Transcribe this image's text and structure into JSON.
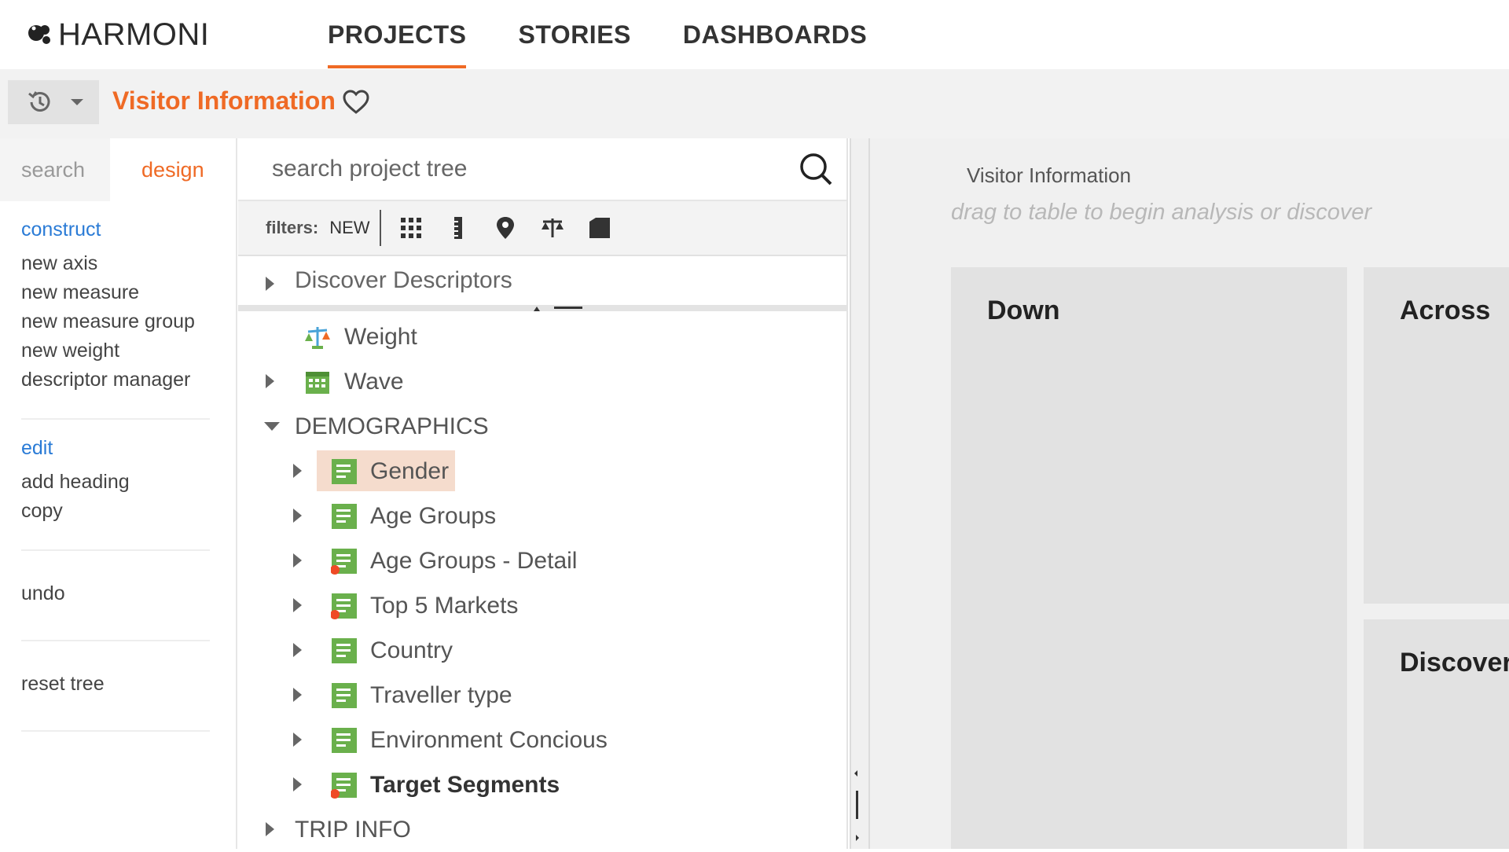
{
  "app": {
    "logo_text": "HARMONI",
    "nav": [
      {
        "label": "PROJECTS",
        "active": true
      },
      {
        "label": "STORIES",
        "active": false
      },
      {
        "label": "DASHBOARDS",
        "active": false
      }
    ],
    "accent_color": "#ef6a25"
  },
  "titlebar": {
    "title": "Visitor Information",
    "history_icon": "history-icon",
    "favorite_icon": "heart-outline-icon"
  },
  "sidebar": {
    "tabs": [
      {
        "label": "search",
        "active": false
      },
      {
        "label": "design",
        "active": true
      }
    ],
    "construct": {
      "heading": "construct",
      "items": [
        "new axis",
        "new measure",
        "new measure group",
        "new weight",
        "descriptor manager"
      ]
    },
    "edit": {
      "heading": "edit",
      "items": [
        "add heading",
        "copy"
      ]
    },
    "undo": "undo",
    "reset": "reset tree"
  },
  "tree_panel": {
    "search_placeholder": "search project tree",
    "filters_label": "filters:",
    "filters_new": "NEW",
    "filter_icons": [
      "grid-icon",
      "ruler-icon",
      "map-pin-icon",
      "weight-scale-icon",
      "folder-icon"
    ],
    "discover": "Discover Descriptors",
    "nodes": [
      {
        "label": "Weight",
        "icon": "weight-icon"
      },
      {
        "label": "Wave",
        "icon": "calendar-icon"
      },
      {
        "label": "DEMOGRAPHICS"
      },
      {
        "label": "Gender",
        "selected": true
      },
      {
        "label": "Age Groups"
      },
      {
        "label": "Age Groups - Detail"
      },
      {
        "label": "Top 5 Markets"
      },
      {
        "label": "Country"
      },
      {
        "label": "Traveller type"
      },
      {
        "label": "Environment Concious"
      },
      {
        "label": "Target Segments",
        "bold": true
      },
      {
        "label": "TRIP INFO"
      }
    ]
  },
  "workspace": {
    "title": "Visitor Information",
    "hint": "drag to table to begin analysis or discover",
    "zones": {
      "down": "Down",
      "across": "Across",
      "discover": "Discover"
    }
  }
}
